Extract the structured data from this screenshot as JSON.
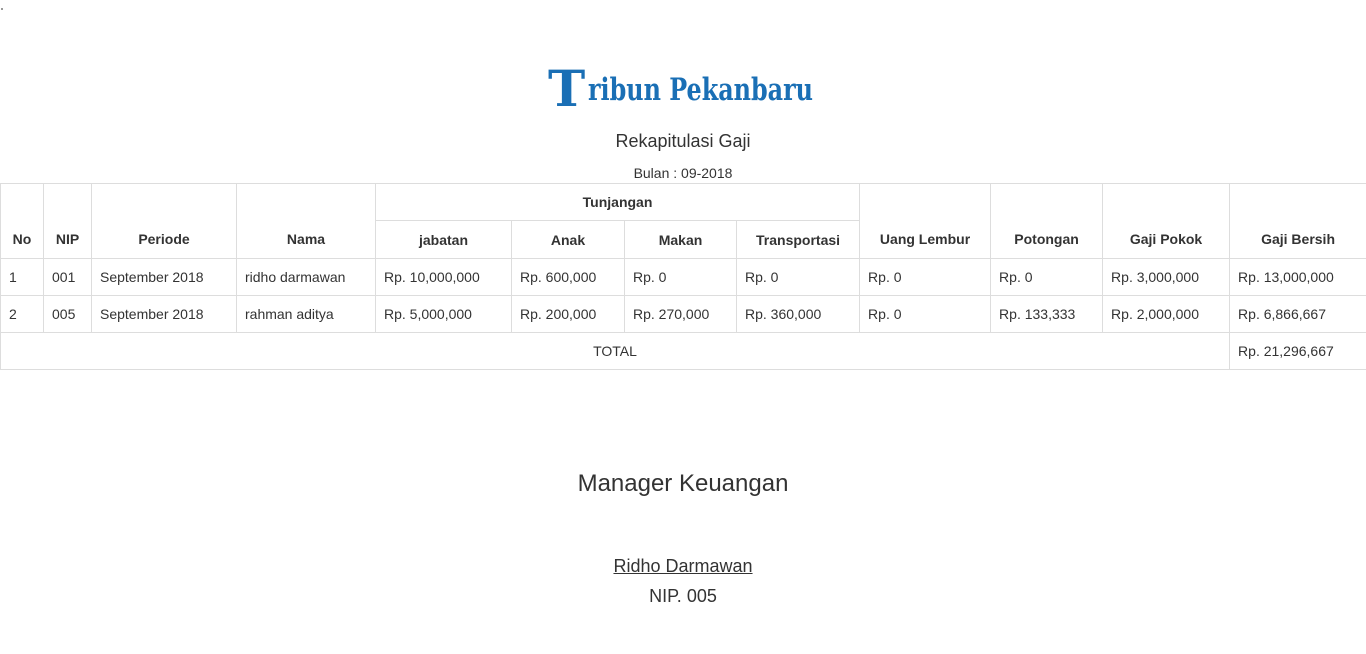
{
  "brand": {
    "logo_text": "Tribun Pekanbaru",
    "logo_color": "#1a6fb5"
  },
  "report": {
    "title": "Rekapitulasi Gaji",
    "month_label": "Bulan : 09-2018"
  },
  "table": {
    "headers": {
      "no": "No",
      "nip": "NIP",
      "periode": "Periode",
      "nama": "Nama",
      "tunjangan": "Tunjangan",
      "jabatan": "jabatan",
      "anak": "Anak",
      "makan": "Makan",
      "transportasi": "Transportasi",
      "uang_lembur": "Uang Lembur",
      "potongan": "Potongan",
      "gaji_pokok": "Gaji Pokok",
      "gaji_bersih": "Gaji Bersih"
    },
    "rows": [
      {
        "no": "1",
        "nip": "001",
        "periode": "September 2018",
        "nama": "ridho darmawan",
        "jabatan": "Rp. 10,000,000",
        "anak": "Rp. 600,000",
        "makan": "Rp. 0",
        "transportasi": "Rp. 0",
        "uang_lembur": "Rp. 0",
        "potongan": "Rp. 0",
        "gaji_pokok": "Rp. 3,000,000",
        "gaji_bersih": "Rp. 13,000,000"
      },
      {
        "no": "2",
        "nip": "005",
        "periode": "September 2018",
        "nama": "rahman aditya",
        "jabatan": "Rp. 5,000,000",
        "anak": "Rp. 200,000",
        "makan": "Rp. 270,000",
        "transportasi": "Rp. 360,000",
        "uang_lembur": "Rp. 0",
        "potongan": "Rp. 133,333",
        "gaji_pokok": "Rp. 2,000,000",
        "gaji_bersih": "Rp. 6,866,667"
      }
    ],
    "total_label": "TOTAL",
    "total_value": "Rp. 21,296,667"
  },
  "signature": {
    "title": "Manager Keuangan",
    "name": "Ridho Darmawan",
    "nip": "NIP. 005"
  }
}
